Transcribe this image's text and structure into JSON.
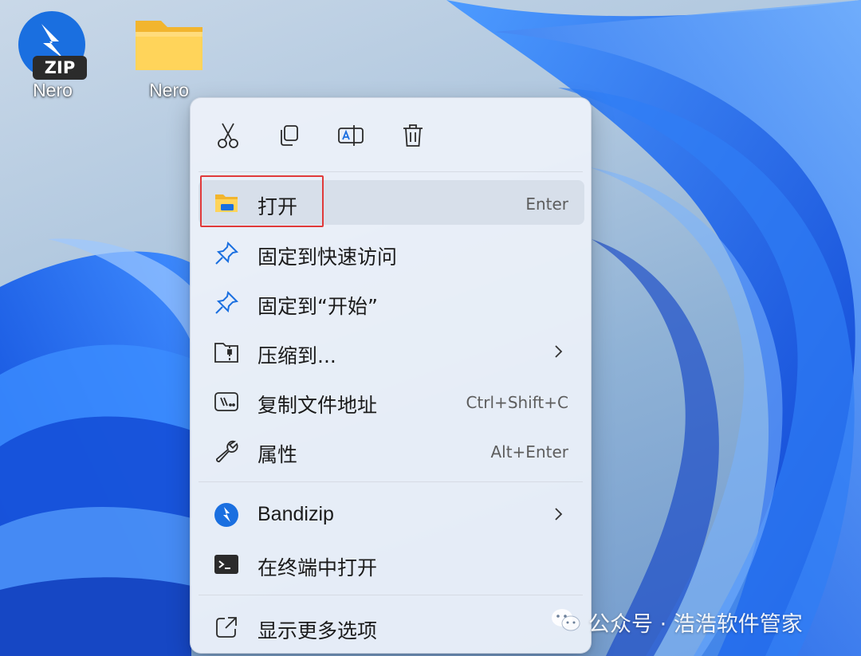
{
  "desktop": {
    "icons": [
      {
        "label": "Nero",
        "icon": "bandizip-zip-icon"
      },
      {
        "label": "Nero",
        "icon": "folder-icon"
      }
    ]
  },
  "context_menu": {
    "toolbar": [
      {
        "name": "cut",
        "icon": "scissors-icon"
      },
      {
        "name": "copy",
        "icon": "copy-icon"
      },
      {
        "name": "rename",
        "icon": "rename-icon"
      },
      {
        "name": "delete",
        "icon": "trash-icon"
      }
    ],
    "items": [
      {
        "label": "打开",
        "shortcut": "Enter",
        "icon": "folder-open-icon",
        "selected": true
      },
      {
        "label": "固定到快速访问",
        "shortcut": "",
        "icon": "pin-icon"
      },
      {
        "label": "固定到“开始”",
        "shortcut": "",
        "icon": "pin-icon"
      },
      {
        "label": "压缩到...",
        "shortcut": "",
        "icon": "zip-folder-icon",
        "submenu": true
      },
      {
        "label": "复制文件地址",
        "shortcut": "Ctrl+Shift+C",
        "icon": "copy-path-icon"
      },
      {
        "label": "属性",
        "shortcut": "Alt+Enter",
        "icon": "wrench-icon"
      },
      {
        "label": "Bandizip",
        "shortcut": "",
        "icon": "bandizip-icon",
        "submenu": true
      },
      {
        "label": "在终端中打开",
        "shortcut": "",
        "icon": "terminal-icon"
      },
      {
        "label": "显示更多选项",
        "shortcut": "",
        "icon": "show-more-icon"
      }
    ]
  },
  "watermark": {
    "text": "公众号 · 浩浩软件管家",
    "icon": "wechat-icon"
  },
  "colors": {
    "accent_blue": "#1a6fe0",
    "folder_yellow": "#f7c948",
    "highlight_red": "#e03a3a",
    "menu_bg": "#eef2fa"
  }
}
